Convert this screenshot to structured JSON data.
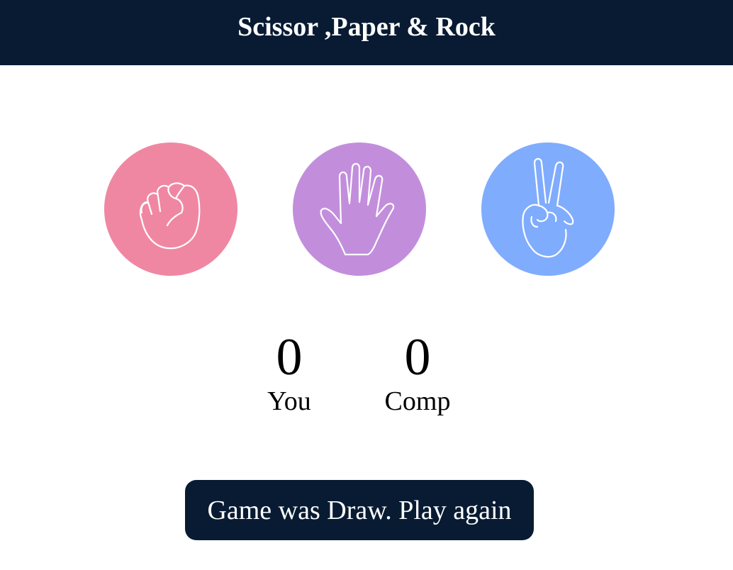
{
  "header": {
    "title": "Scissor ,Paper & Rock"
  },
  "choices": [
    {
      "name": "rock",
      "icon": "fist-icon",
      "color": "#ef87a3"
    },
    {
      "name": "paper",
      "icon": "open-hand-icon",
      "color": "#c28edc"
    },
    {
      "name": "scissors",
      "icon": "peace-hand-icon",
      "color": "#80acfd"
    }
  ],
  "scoreboard": {
    "user_score": "0",
    "user_label": "You",
    "comp_score": "0",
    "comp_label": "Comp"
  },
  "message": {
    "text": "Game was Draw. Play again"
  },
  "colors": {
    "header_bg": "#081b33",
    "message_bg": "#081b33"
  }
}
